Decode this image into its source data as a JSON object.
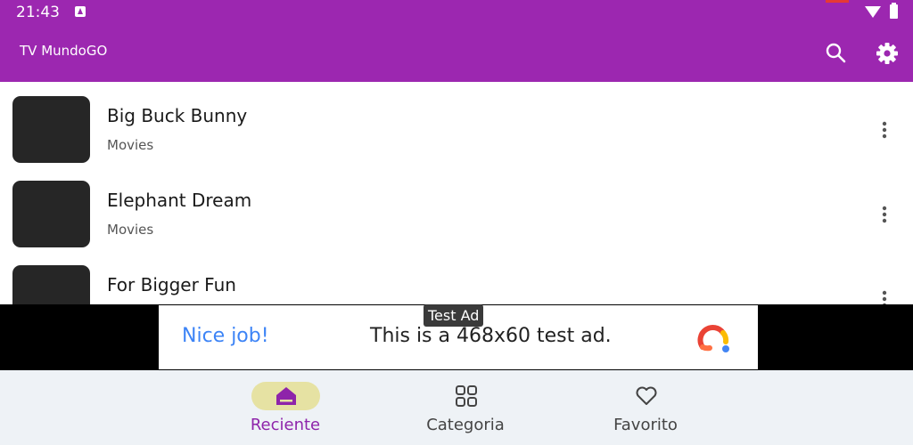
{
  "status": {
    "time": "21:43"
  },
  "appbar": {
    "title": "TV MundoGO",
    "search_icon": "search-icon",
    "settings_icon": "gear-icon"
  },
  "list": {
    "items": [
      {
        "title": "Big Buck Bunny",
        "category": "Movies"
      },
      {
        "title": "Elephant Dream",
        "category": "Movies"
      },
      {
        "title": "For Bigger Fun",
        "category": ""
      }
    ]
  },
  "ad": {
    "tag": "Test Ad",
    "headline": "Nice job!",
    "body": "This is a 468x60 test ad."
  },
  "nav": {
    "items": [
      {
        "label": "Reciente",
        "icon": "home-icon",
        "active": true
      },
      {
        "label": "Categoria",
        "icon": "grid-icon",
        "active": false
      },
      {
        "label": "Favorito",
        "icon": "heart-icon",
        "active": false
      }
    ]
  },
  "colors": {
    "primary": "#9c27b0",
    "active_pill": "#e6e2a3",
    "active_label": "#8e24aa",
    "ad_link": "#3d84f6"
  }
}
